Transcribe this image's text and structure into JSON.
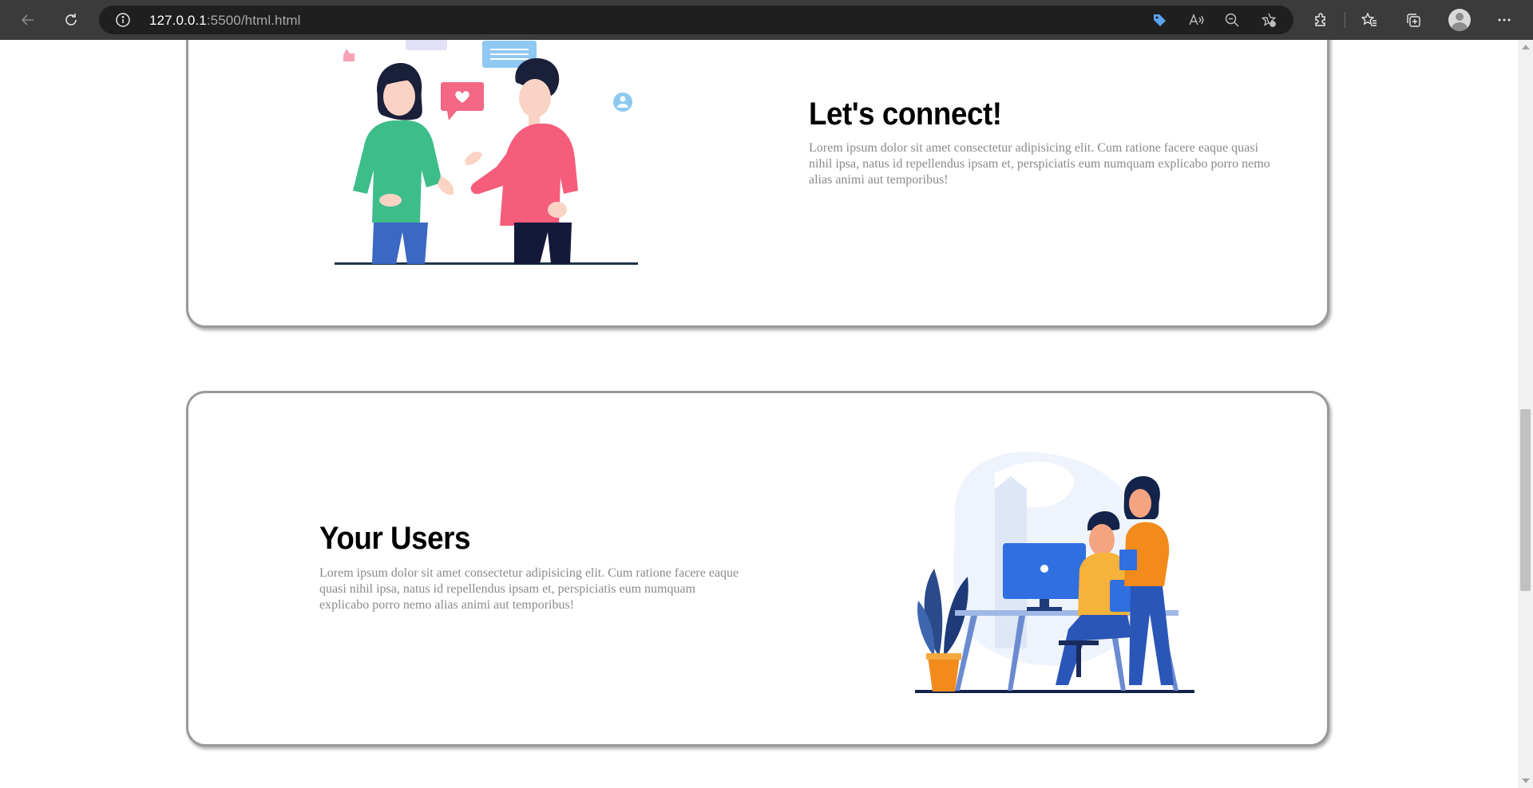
{
  "browser": {
    "url_host": "127.0.0.1",
    "url_path": ":5500/html.html",
    "icons": {
      "back": "back-arrow-icon",
      "reload": "reload-icon",
      "site_info": "info-icon",
      "tag": "tag-icon",
      "read_aloud": "read-aloud-icon",
      "zoom": "zoom-out-icon",
      "add_favorite": "add-favorite-icon",
      "extensions": "extensions-icon",
      "favorites": "favorites-icon",
      "collections": "collections-icon",
      "profile": "profile-avatar",
      "more": "more-options-icon"
    }
  },
  "sections": [
    {
      "title": "Let's connect!",
      "text": "Lorem ipsum dolor sit amet consectetur adipisicing elit. Cum ratione facere eaque quasi nihil ipsa, natus id repellendus ipsam et, perspiciatis eum numquam explicabo porro nemo alias animi aut temporibus!",
      "illustration": "two-people-chatting-illustration"
    },
    {
      "title": "Your Users",
      "text": "Lorem ipsum dolor sit amet consectetur adipisicing elit. Cum ratione facere eaque quasi nihil ipsa, natus id repellendus ipsam et, perspiciatis eum numquam explicabo porro nemo alias animi aut temporibus!",
      "illustration": "office-workers-at-desk-illustration"
    }
  ],
  "colors": {
    "toolbar": "#3b3b3b",
    "addressbar": "#1f1f1f",
    "card_border": "#9a9a9a",
    "body_text": "#8a8a8a"
  }
}
